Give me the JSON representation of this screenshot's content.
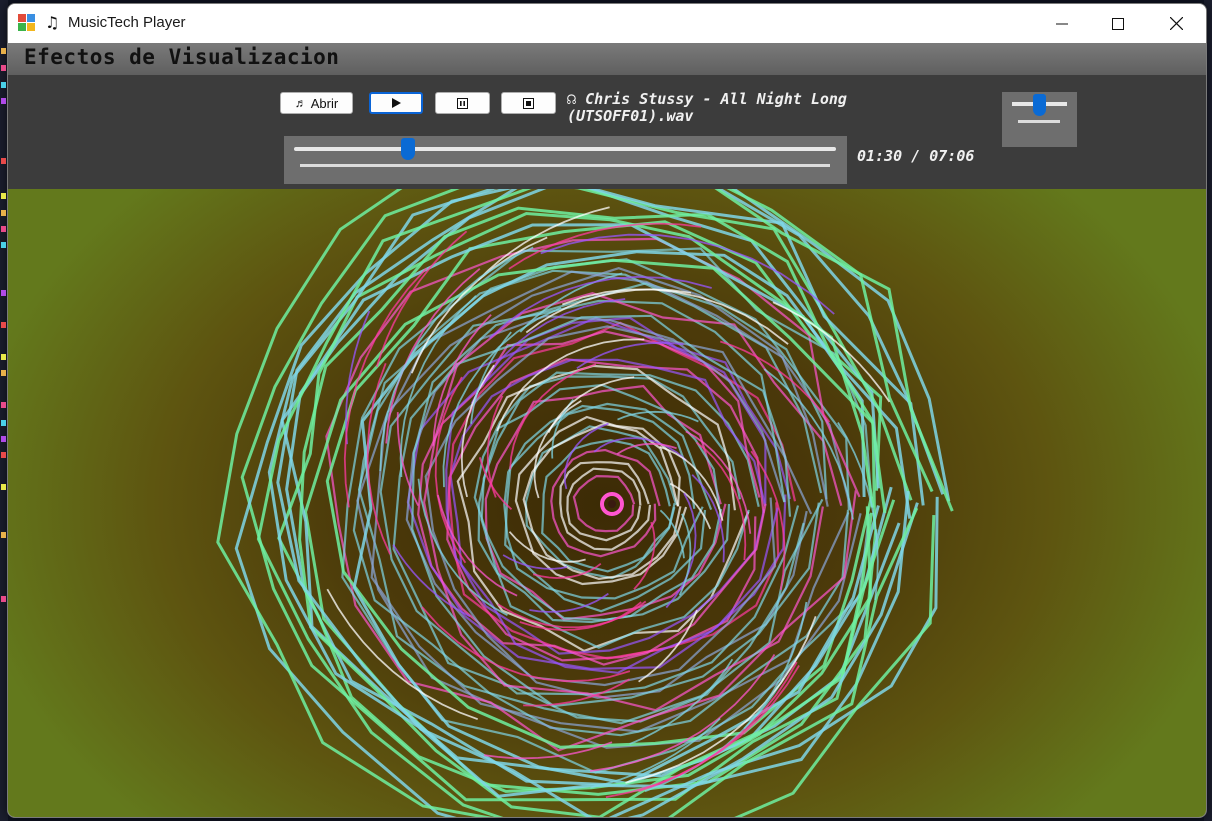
{
  "window": {
    "title": "MusicTech Player",
    "app_icon": "app-icon",
    "music_icon": "music-notes-icon",
    "controls": [
      "minimize-icon",
      "maximize-icon",
      "close-icon"
    ]
  },
  "header": {
    "title": "Efectos de Visualizacion"
  },
  "player": {
    "open_label": "Abrir",
    "open_icon": "music-note-icon",
    "play_icon": "play-icon",
    "pause_icon": "pause-icon",
    "stop_icon": "stop-icon",
    "track_icon": "headphones-icon",
    "track_name": "Chris Stussy - All Night Long (UTSOFF01).wav",
    "elapsed": "01:30",
    "total": "07:06",
    "time_display": "01:30 / 07:06",
    "seek_position": 0.21,
    "volume_level": 0.55
  },
  "visualizer": {
    "effect": "spiral-rings",
    "colors": [
      "#6ef0a0",
      "#7fd6e6",
      "#8aa6d8",
      "#ff55d0",
      "#ffffff",
      "#9955ff",
      "#ff3aa0"
    ],
    "background": [
      "#3c2b05",
      "#5e5510",
      "#63791c"
    ]
  }
}
